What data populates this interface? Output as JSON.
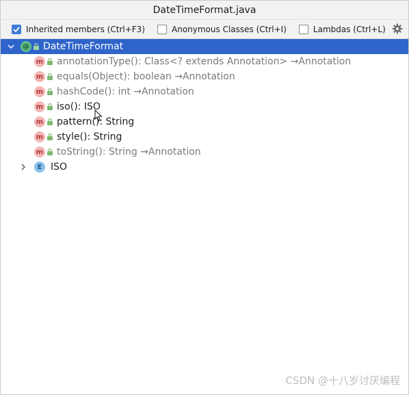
{
  "window": {
    "title": "DateTimeFormat.java"
  },
  "options": {
    "inherited": {
      "label": "Inherited members (Ctrl+F3)",
      "checked": true
    },
    "anonymous": {
      "label": "Anonymous Classes (Ctrl+I)",
      "checked": false
    },
    "lambdas": {
      "label": "Lambdas (Ctrl+L)",
      "checked": false
    },
    "settings_icon": "gear-icon"
  },
  "tree": {
    "root": {
      "label": "DateTimeFormat",
      "icon": "annotation-icon",
      "badge": "@",
      "expanded": true,
      "selected": true
    },
    "members": [
      {
        "label": "annotationType(): Class<? extends Annotation> →Annotation",
        "inherited": true,
        "badge": "m"
      },
      {
        "label": "equals(Object): boolean →Annotation",
        "inherited": true,
        "badge": "m"
      },
      {
        "label": "hashCode(): int →Annotation",
        "inherited": true,
        "badge": "m"
      },
      {
        "label": "iso(): ISO",
        "inherited": false,
        "badge": "m"
      },
      {
        "label": "pattern(): String",
        "inherited": false,
        "badge": "m"
      },
      {
        "label": "style(): String",
        "inherited": false,
        "badge": "m"
      },
      {
        "label": "toString(): String →Annotation",
        "inherited": true,
        "badge": "m"
      }
    ],
    "nested": {
      "label": "ISO",
      "icon": "enum-icon",
      "badge": "E",
      "expanded": false
    }
  },
  "watermark": "CSDN @十八岁讨厌编程",
  "colors": {
    "selection": "#2f65ca",
    "checkbox_accent": "#3f7dd6",
    "inherited_text": "#7a7a7a"
  }
}
